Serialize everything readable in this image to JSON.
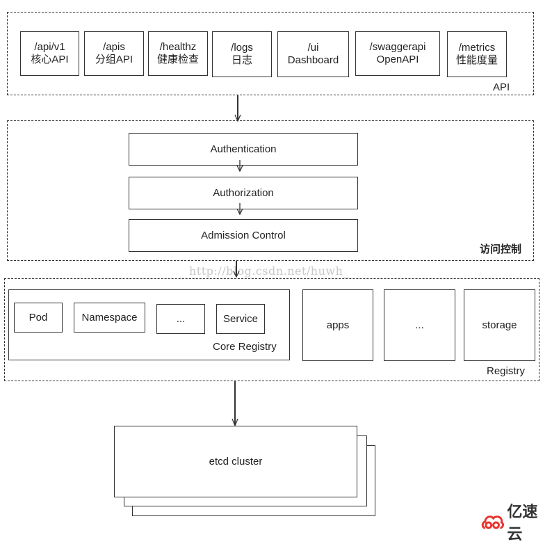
{
  "api_layer": {
    "label": "API",
    "endpoints": [
      {
        "path": "/api/v1",
        "desc": "核心API"
      },
      {
        "path": "/apis",
        "desc": "分组API"
      },
      {
        "path": "/healthz",
        "desc": "健康检查"
      },
      {
        "path": "/logs",
        "desc": "日志"
      },
      {
        "path": "/ui",
        "desc": "Dashboard"
      },
      {
        "path": "/swaggerapi",
        "desc": "OpenAPI"
      },
      {
        "path": "/metrics",
        "desc": "性能度量"
      }
    ]
  },
  "access_control": {
    "label": "访问控制",
    "steps": [
      "Authentication",
      "Authorization",
      "Admission Control"
    ]
  },
  "registry": {
    "label": "Registry",
    "core": {
      "label": "Core Registry",
      "items": [
        "Pod",
        "Namespace",
        "...",
        "Service"
      ]
    },
    "groups": [
      "apps",
      "...",
      "storage"
    ]
  },
  "storage": {
    "label": "etcd cluster"
  },
  "watermark": "http://blog.csdn.net/huwh_",
  "logo": {
    "text": "亿速云",
    "color": "#e8342c"
  }
}
